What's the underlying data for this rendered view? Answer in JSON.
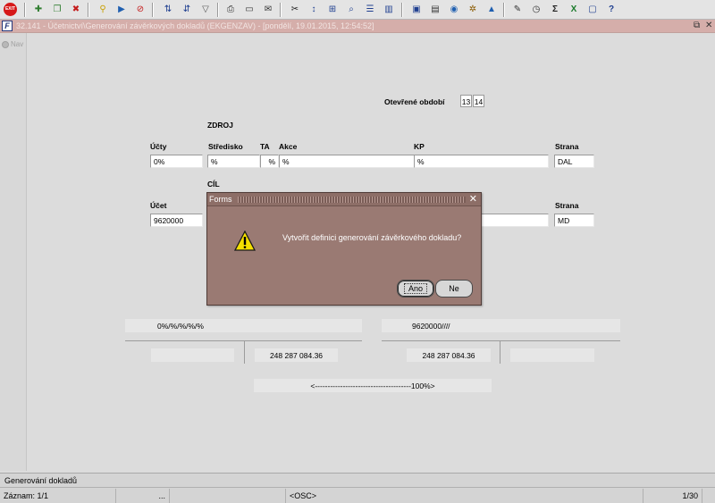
{
  "toolbar": {
    "exit_label": "EXIT",
    "icons": [
      "exit-icon",
      "new-record-icon",
      "duplicate-record-icon",
      "delete-record-icon",
      "query-icon",
      "execute-query-icon",
      "cancel-query-icon",
      "clear-icon",
      "sort-ascending-icon",
      "sort-descending-icon",
      "filter-icon",
      "print-icon",
      "attachment-icon",
      "mail-icon",
      "cut-icon",
      "move-icon",
      "tree-icon",
      "find-icon",
      "list-icon",
      "columns-icon",
      "export-icon",
      "notes-icon",
      "globe-icon",
      "settings-icon",
      "chart-icon",
      "edit-icon",
      "clock-icon",
      "sum-icon",
      "excel-icon",
      "window-icon",
      "help-icon"
    ]
  },
  "window": {
    "title": "32.141 - Účetnictví\\Generování závěrkových dokladů (EKGENZAV) - [pondělí, 19.01.2015, 12:54:52]"
  },
  "nav": {
    "label": "Nav"
  },
  "form": {
    "period_label": "Otevřené období",
    "periods": [
      "13",
      "14"
    ],
    "source_header": "ZDROJ",
    "target_header": "CÍL",
    "labels": {
      "accounts": "Účty",
      "cost_center": "Středisko",
      "ta": "TA",
      "action": "Akce",
      "kp": "KP",
      "side": "Strana",
      "account": "Účet"
    },
    "source": {
      "accounts": "0%",
      "cost_center": "%",
      "ta": "%",
      "action": "%",
      "kp": "%",
      "side": "DAL"
    },
    "target": {
      "account": "9620000",
      "side": "MD"
    },
    "summary": {
      "left_mask": "0%/%/%/%/%",
      "right_mask": "9620000////",
      "left_amount": "248 287 084.36",
      "right_amount": "248 287 084.36",
      "progress": "<--------------------------------------100%>"
    }
  },
  "dialog": {
    "title": "Forms",
    "message": "Vytvořit definici generování závěrkového dokladu?",
    "yes_label": "Ano",
    "no_label": "Ne"
  },
  "status": {
    "message": "Generování dokladů",
    "record": "Záznam: 1/1",
    "ellipsis": "...",
    "mode": "<OSC>",
    "page": "1/30"
  }
}
